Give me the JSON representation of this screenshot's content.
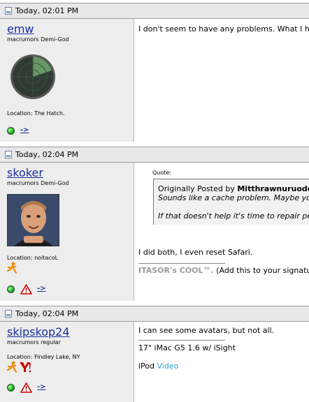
{
  "posts": [
    {
      "date": "Today, 02:01 PM",
      "username": "emw",
      "user_title": "macrumors Demi-God",
      "location": "Location: The Hatch.",
      "online_link": "->",
      "message": "I don't seem to have any problems. What I have been visiting for"
    },
    {
      "date": "Today, 02:04 PM",
      "username": "skoker",
      "user_title": "macrumors Demi-God",
      "location": "Location: noitacoL",
      "online_link": "->",
      "quote_label": "Quote:",
      "quote_author_prefix": "Originally Posted by ",
      "quote_author": "Mitthrawnuruodo",
      "quote_line1": "Sounds like a cache problem. Maybe you have to empty",
      "quote_line2": "If that doesn't help it's time to repair permissions",
      "message": "I did both, I even reset Safari.",
      "signature_bold": "ITASOR's COOL™.",
      "signature_rest": " (Add this to your signature if you agree)"
    },
    {
      "date": "Today, 02:04 PM",
      "username": "skipskop24",
      "user_title": "macrumors regular",
      "location": "Location: Findley Lake, NY",
      "online_link": "->",
      "message": "I can see some avatars, but not all.",
      "signature_line1": "17\" iMac G5 1.6 w/ iSight",
      "signature_ipod": "iPod ",
      "signature_video": "Video"
    }
  ],
  "colors": {
    "header_bg": "#e8e8e8",
    "sidebar_bg": "#ededed",
    "link": "#1a2fa0",
    "online_green": "#18b018",
    "warning_red": "#cc0000",
    "aim_orange": "#f08a00"
  },
  "icons": [
    "document-icon",
    "radar-avatar",
    "online-status-icon",
    "warning-icon",
    "aim-icon",
    "yahoo-icon"
  ]
}
